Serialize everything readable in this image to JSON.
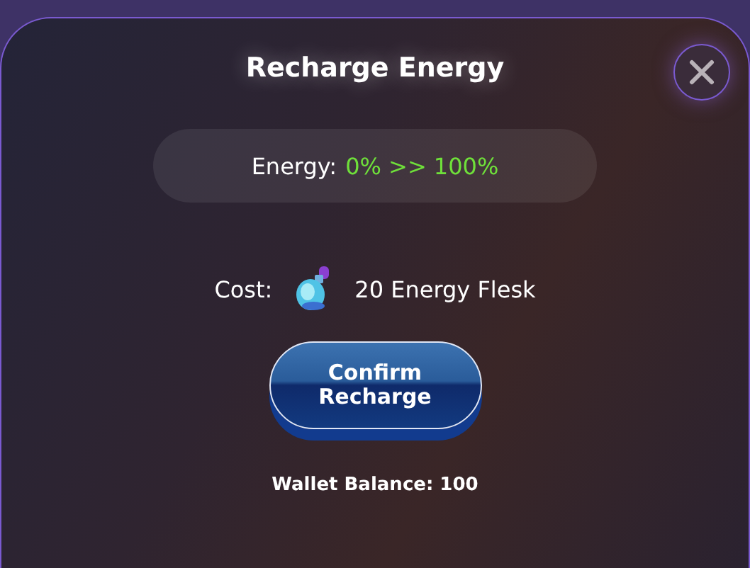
{
  "dialog": {
    "title": "Recharge Energy"
  },
  "energy": {
    "label": "Energy:",
    "value": "0% >> 100%"
  },
  "cost": {
    "label": "Cost:",
    "amount": "20 Energy Flesk"
  },
  "confirm_button": {
    "lines": [
      "Confirm",
      "Recharge"
    ]
  },
  "wallet_balance": "Wallet Balance: 100"
}
